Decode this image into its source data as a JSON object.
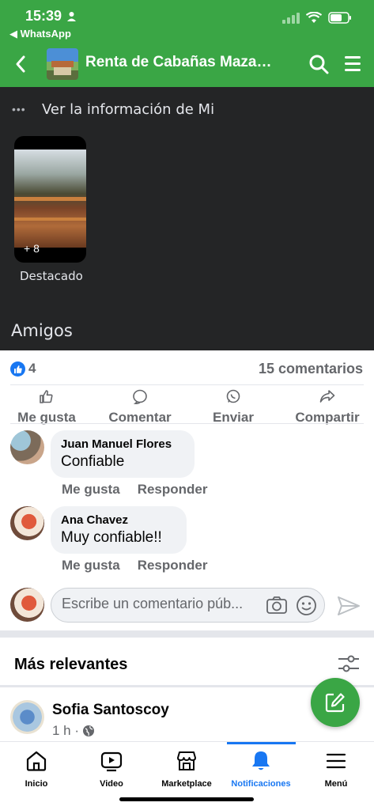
{
  "status": {
    "time": "15:39",
    "back_app": "◀ WhatsApp"
  },
  "header": {
    "title": "Renta de Cabañas Maza…"
  },
  "shared": {
    "dots": "•••",
    "info_text": "Ver la información de Mi",
    "story_count": "+ 8",
    "story_label": "Destacado",
    "friends_heading": "Amigos"
  },
  "reactions": {
    "count": "4",
    "comments": "15 comentarios"
  },
  "actions": {
    "like": "Me gusta",
    "comment": "Comentar",
    "send": "Enviar",
    "share": "Compartir"
  },
  "comments": [
    {
      "name": "Juan Manuel Flores",
      "text": "Confiable",
      "like": "Me gusta",
      "reply": "Responder"
    },
    {
      "name": "Ana Chavez",
      "text": "Muy confiable!!",
      "like": "Me gusta",
      "reply": "Responder"
    }
  ],
  "composer": {
    "placeholder": "Escribe un comentario púb..."
  },
  "sort": {
    "label": "Más relevantes"
  },
  "next_post": {
    "name": "Sofia Santoscoy",
    "time": "1 h ·"
  },
  "nav": [
    {
      "label": "Inicio",
      "icon": "home-icon"
    },
    {
      "label": "Video",
      "icon": "video-icon"
    },
    {
      "label": "Marketplace",
      "icon": "marketplace-icon"
    },
    {
      "label": "Notificaciones",
      "icon": "bell-icon",
      "active": true
    },
    {
      "label": "Menú",
      "icon": "hamburger-icon"
    }
  ],
  "colors": {
    "header_green": "#3aa645",
    "dark_bg": "#242526",
    "fb_blue": "#1877f2",
    "muted": "#65676b"
  }
}
